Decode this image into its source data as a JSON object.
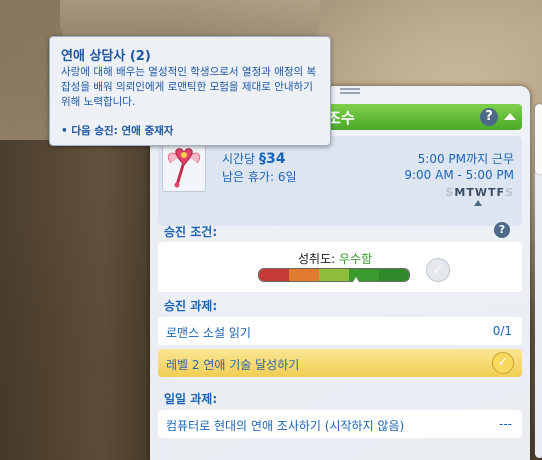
{
  "tooltip": {
    "title": "연애 상담사 (2)",
    "description": "사랑에 대해 배우는 열성적인 학생으로서 열정과 애정의 복잡성을 배워 의뢰인에게 로맨틱한 모험을 제대로 안내하기 위해 노력합니다.",
    "next_promotion": "• 다음 승진: 연애 중재자"
  },
  "career": {
    "title": "성 조수",
    "help_icon": "?",
    "hourly_label": "시간당",
    "hourly_wage": "§34",
    "vacation": "남은 휴가: 6일",
    "work_until": "5:00 PM까지 근무",
    "hours": "9:00 AM - 5:00 PM",
    "days": [
      "S",
      "M",
      "T",
      "W",
      "T",
      "F",
      "S"
    ],
    "workdays": [
      false,
      true,
      true,
      true,
      true,
      true,
      false
    ]
  },
  "promotion": {
    "header": "승진 조건:",
    "performance_key": "성취도:",
    "performance_value": "우수함",
    "performance_level": 0.65,
    "meter_colors": [
      "#c43a35",
      "#e07a2e",
      "#8fbf3a",
      "#3a9a2e",
      "#2f8a2a"
    ]
  },
  "promotion_tasks": {
    "header": "승진 과제:",
    "items": [
      {
        "label": "로맨스 소설 읽기",
        "value": "0/1"
      },
      {
        "label": "레벨 2 연애 기술 달성하기",
        "value": "",
        "complete": true
      }
    ]
  },
  "daily_tasks": {
    "header": "일일 과제:",
    "items": [
      {
        "label": "컴퓨터로 현대의 연애 조사하기 (시작하지 않음)",
        "value": "---"
      }
    ]
  }
}
